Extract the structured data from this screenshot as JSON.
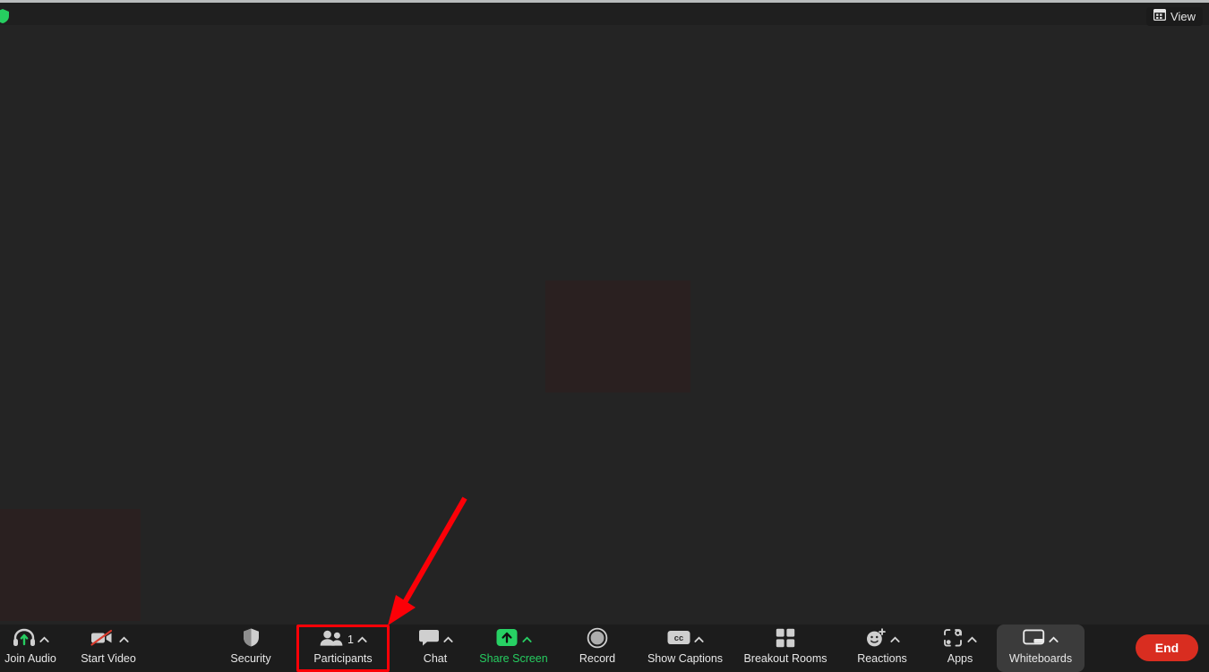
{
  "app": {
    "name": "Zoom Meeting",
    "background_color": "#242424",
    "toolbar_color": "#1c1c1c"
  },
  "top_bar": {
    "encryption_icon": "encryption-shield-icon",
    "view_button": {
      "label": "View",
      "icon": "grid-view-icon"
    }
  },
  "stage": {
    "tiles": [
      {
        "name": "video-tile-center",
        "color": "#2a2020"
      },
      {
        "name": "video-tile-corner",
        "color": "#2a2020"
      }
    ]
  },
  "toolbar": {
    "items": [
      {
        "id": "join-audio",
        "label": "Join Audio",
        "icon": "headset-icon",
        "has_chevron": true,
        "label_color": "#e8e8e8",
        "active": false
      },
      {
        "id": "start-video",
        "label": "Start Video",
        "icon": "video-off-icon",
        "has_chevron": true,
        "label_color": "#e8e8e8",
        "active": false
      },
      {
        "id": "security",
        "label": "Security",
        "icon": "shield-icon",
        "has_chevron": false,
        "label_color": "#e8e8e8",
        "active": false
      },
      {
        "id": "participants",
        "label": "Participants",
        "icon": "participants-icon",
        "count": "1",
        "has_chevron": true,
        "label_color": "#e8e8e8",
        "active": false,
        "highlighted": true
      },
      {
        "id": "chat",
        "label": "Chat",
        "icon": "chat-bubble-icon",
        "has_chevron": true,
        "label_color": "#e8e8e8",
        "active": false
      },
      {
        "id": "share-screen",
        "label": "Share Screen",
        "icon": "share-screen-icon",
        "has_chevron": true,
        "label_color": "#26cd60",
        "active": false
      },
      {
        "id": "record",
        "label": "Record",
        "icon": "record-icon",
        "has_chevron": false,
        "label_color": "#e8e8e8",
        "active": false
      },
      {
        "id": "show-captions",
        "label": "Show Captions",
        "icon": "closed-captions-icon",
        "has_chevron": true,
        "label_color": "#e8e8e8",
        "active": false
      },
      {
        "id": "breakout-rooms",
        "label": "Breakout Rooms",
        "icon": "breakout-rooms-icon",
        "has_chevron": false,
        "label_color": "#e8e8e8",
        "active": false
      },
      {
        "id": "reactions",
        "label": "Reactions",
        "icon": "reactions-icon",
        "has_chevron": true,
        "label_color": "#e8e8e8",
        "active": false
      },
      {
        "id": "apps",
        "label": "Apps",
        "icon": "apps-icon",
        "has_chevron": true,
        "label_color": "#e8e8e8",
        "active": false
      },
      {
        "id": "whiteboards",
        "label": "Whiteboards",
        "icon": "whiteboard-icon",
        "has_chevron": true,
        "label_color": "#e8e8e8",
        "active": true
      }
    ],
    "end_button": {
      "label": "End",
      "color": "#d92d20"
    }
  },
  "annotations": {
    "color": "#fc0007",
    "highlight_target": "participants",
    "arrow": "points-to-participants-button"
  }
}
